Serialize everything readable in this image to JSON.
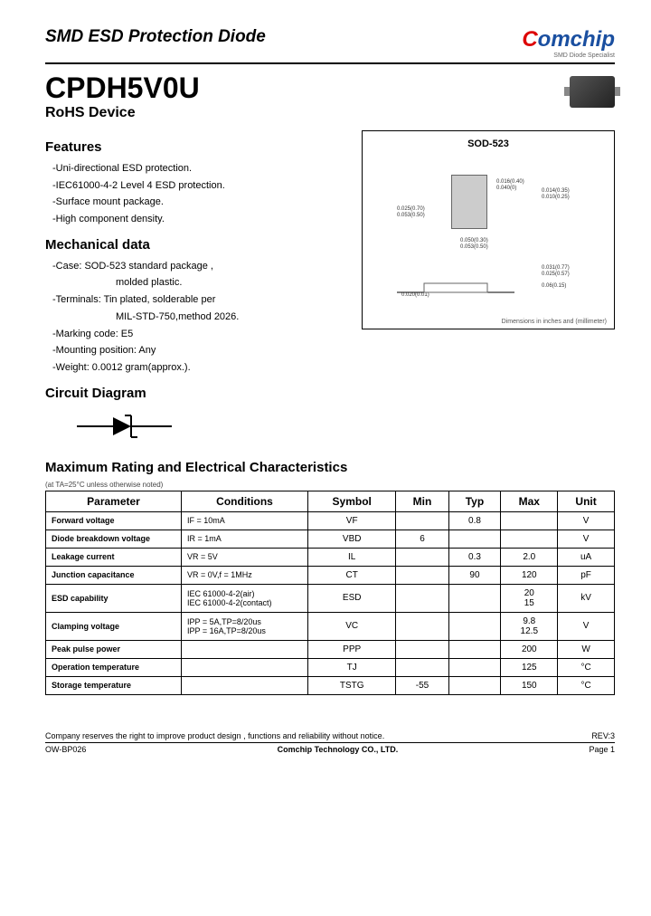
{
  "header": {
    "doc_title": "SMD ESD Protection Diode",
    "logo_text": "Comchip",
    "logo_sub": "SMD Diode Specialist"
  },
  "title": {
    "part": "CPDH5V0U",
    "sub": "RoHS Device"
  },
  "features": {
    "heading": "Features",
    "items": [
      "-Uni-directional ESD protection.",
      "-IEC61000-4-2 Level 4 ESD protection.",
      "-Surface mount package.",
      "-High component density."
    ]
  },
  "mechanical": {
    "heading": "Mechanical data",
    "items": [
      {
        "main": "-Case: SOD-523  standard package ,",
        "sub": "molded plastic."
      },
      {
        "main": "-Terminals:  Tin plated, solderable per",
        "sub": "MIL-STD-750,method 2026."
      },
      {
        "main": "-Marking code: E5",
        "sub": ""
      },
      {
        "main": "-Mounting position: Any",
        "sub": ""
      },
      {
        "main": "-Weight: 0.0012 gram(approx.).",
        "sub": ""
      }
    ]
  },
  "package": {
    "title": "SOD-523",
    "dims": [
      "0.016(0.40)",
      "0.040(0)",
      "0.014(0.35)",
      "0.010(0.25)",
      "0.025(0.70)",
      "0.053(0.50)",
      "0.050(0.30)",
      "0.053(0.50)",
      "0.031(0.77)",
      "0.025(0.57)",
      "0.06(0.15)",
      "0.020(0.01)"
    ],
    "footer": "Dimensions in inches and (millimeter)"
  },
  "circuit": {
    "heading": "Circuit Diagram"
  },
  "ratings": {
    "heading": "Maximum Rating and Electrical Characteristics",
    "note": "(at TA=25°C unless otherwise noted)",
    "headers": [
      "Parameter",
      "Conditions",
      "Symbol",
      "Min",
      "Typ",
      "Max",
      "Unit"
    ],
    "rows": [
      {
        "param": "Forward voltage",
        "cond": "IF = 10mA",
        "sym": "VF",
        "min": "",
        "typ": "0.8",
        "max": "",
        "unit": "V"
      },
      {
        "param": "Diode breakdown voltage",
        "cond": "IR = 1mA",
        "sym": "VBD",
        "min": "6",
        "typ": "",
        "max": "",
        "unit": "V"
      },
      {
        "param": "Leakage current",
        "cond": "VR = 5V",
        "sym": "IL",
        "min": "",
        "typ": "0.3",
        "max": "2.0",
        "unit": "uA"
      },
      {
        "param": "Junction capacitance",
        "cond": "VR = 0V,f = 1MHz",
        "sym": "CT",
        "min": "",
        "typ": "90",
        "max": "120",
        "unit": "pF"
      },
      {
        "param": "ESD capability",
        "cond": "IEC 61000-4-2(air)\nIEC 61000-4-2(contact)",
        "sym": "ESD",
        "min": "",
        "typ": "",
        "max": "20\n15",
        "unit": "kV"
      },
      {
        "param": "Clamping voltage",
        "cond": "IPP =  5A,TP=8/20us\nIPP = 16A,TP=8/20us",
        "sym": "VC",
        "min": "",
        "typ": "",
        "max": "9.8\n12.5",
        "unit": "V"
      },
      {
        "param": "Peak pulse power",
        "cond": "",
        "sym": "PPP",
        "min": "",
        "typ": "",
        "max": "200",
        "unit": "W"
      },
      {
        "param": "Operation temperature",
        "cond": "",
        "sym": "TJ",
        "min": "",
        "typ": "",
        "max": "125",
        "unit": "°C"
      },
      {
        "param": "Storage temperature",
        "cond": "",
        "sym": "TSTG",
        "min": "-55",
        "typ": "",
        "max": "150",
        "unit": "°C"
      }
    ]
  },
  "footer": {
    "note": "Company reserves the right to improve product design , functions and reliability without notice.",
    "rev": "REV:3",
    "code": "OW-BP026",
    "company": "Comchip Technology CO., LTD.",
    "page": "Page 1"
  }
}
